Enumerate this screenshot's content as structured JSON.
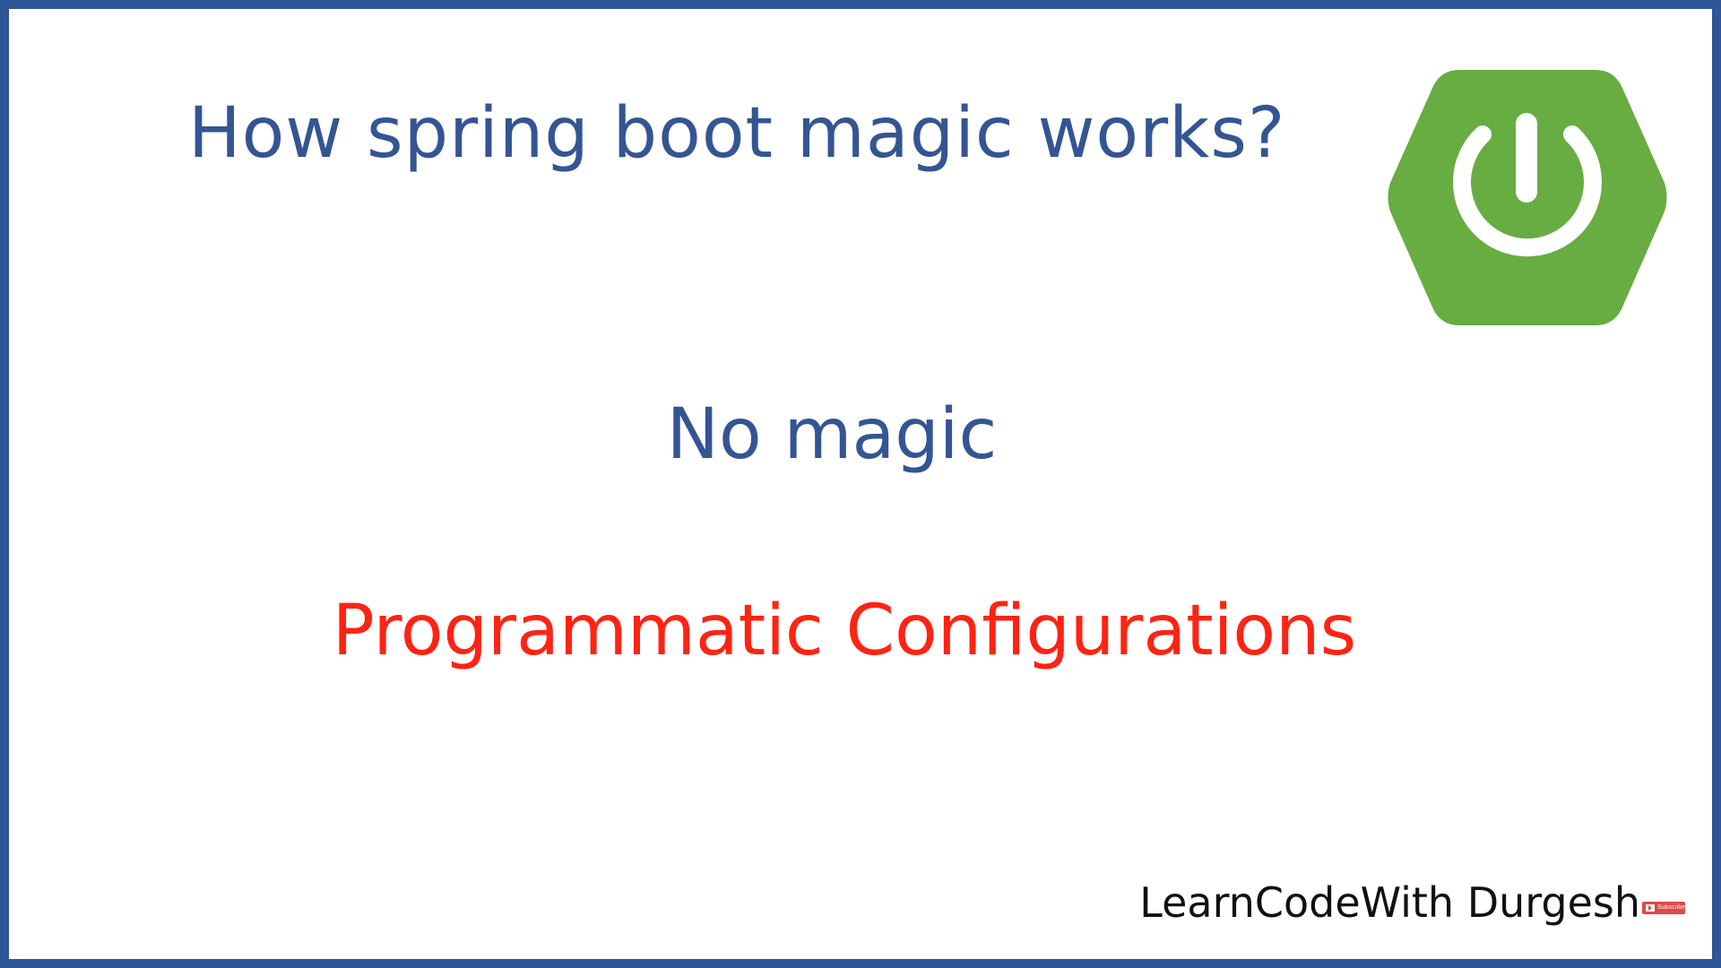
{
  "slide": {
    "title": "How spring boot magic works?",
    "subtitle": "No magic",
    "highlight": "Programmatic Configurations",
    "brand": "LearnCodeWith Durgesh",
    "subscribe_badge_text": "Subscribe",
    "logo_icon": "spring-boot-power-icon"
  },
  "colors": {
    "border": "#2e5597",
    "title": "#345594",
    "highlight": "#ff2313",
    "logo_green": "#67ad42",
    "logo_white": "#ffffff",
    "brand_text": "#111111",
    "badge_red": "#e34646"
  }
}
